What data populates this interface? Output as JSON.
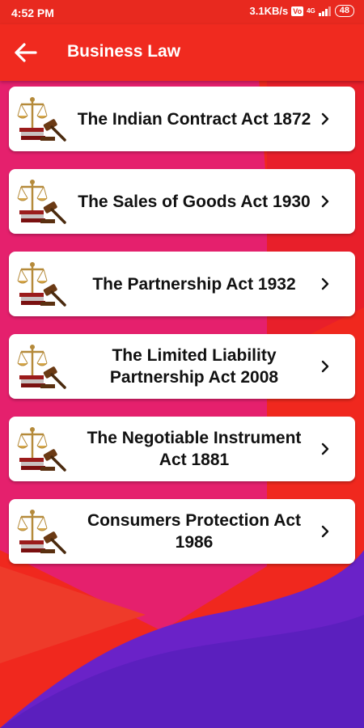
{
  "status_bar": {
    "time": "4:52 PM",
    "speed": "3.1KB/s",
    "volte": "Vo",
    "network": "4G",
    "battery": "48"
  },
  "app_bar": {
    "title": "Business Law"
  },
  "items": [
    {
      "label": "The Indian Contract Act 1872"
    },
    {
      "label": "The Sales of Goods Act 1930"
    },
    {
      "label": "The Partnership Act 1932"
    },
    {
      "label": "The Limited Liability Partnership Act 2008"
    },
    {
      "label": "The Negotiable Instrument Act 1881"
    },
    {
      "label": "Consumers Protection Act 1986"
    }
  ],
  "colors": {
    "app_bar": "#f02a1f",
    "pink": "#e5206d",
    "purple": "#6a22c8",
    "red": "#f0281e"
  },
  "icons": {
    "back": "arrow-left-icon",
    "item": "law-scales-gavel-icon",
    "chevron": "chevron-right-icon"
  }
}
